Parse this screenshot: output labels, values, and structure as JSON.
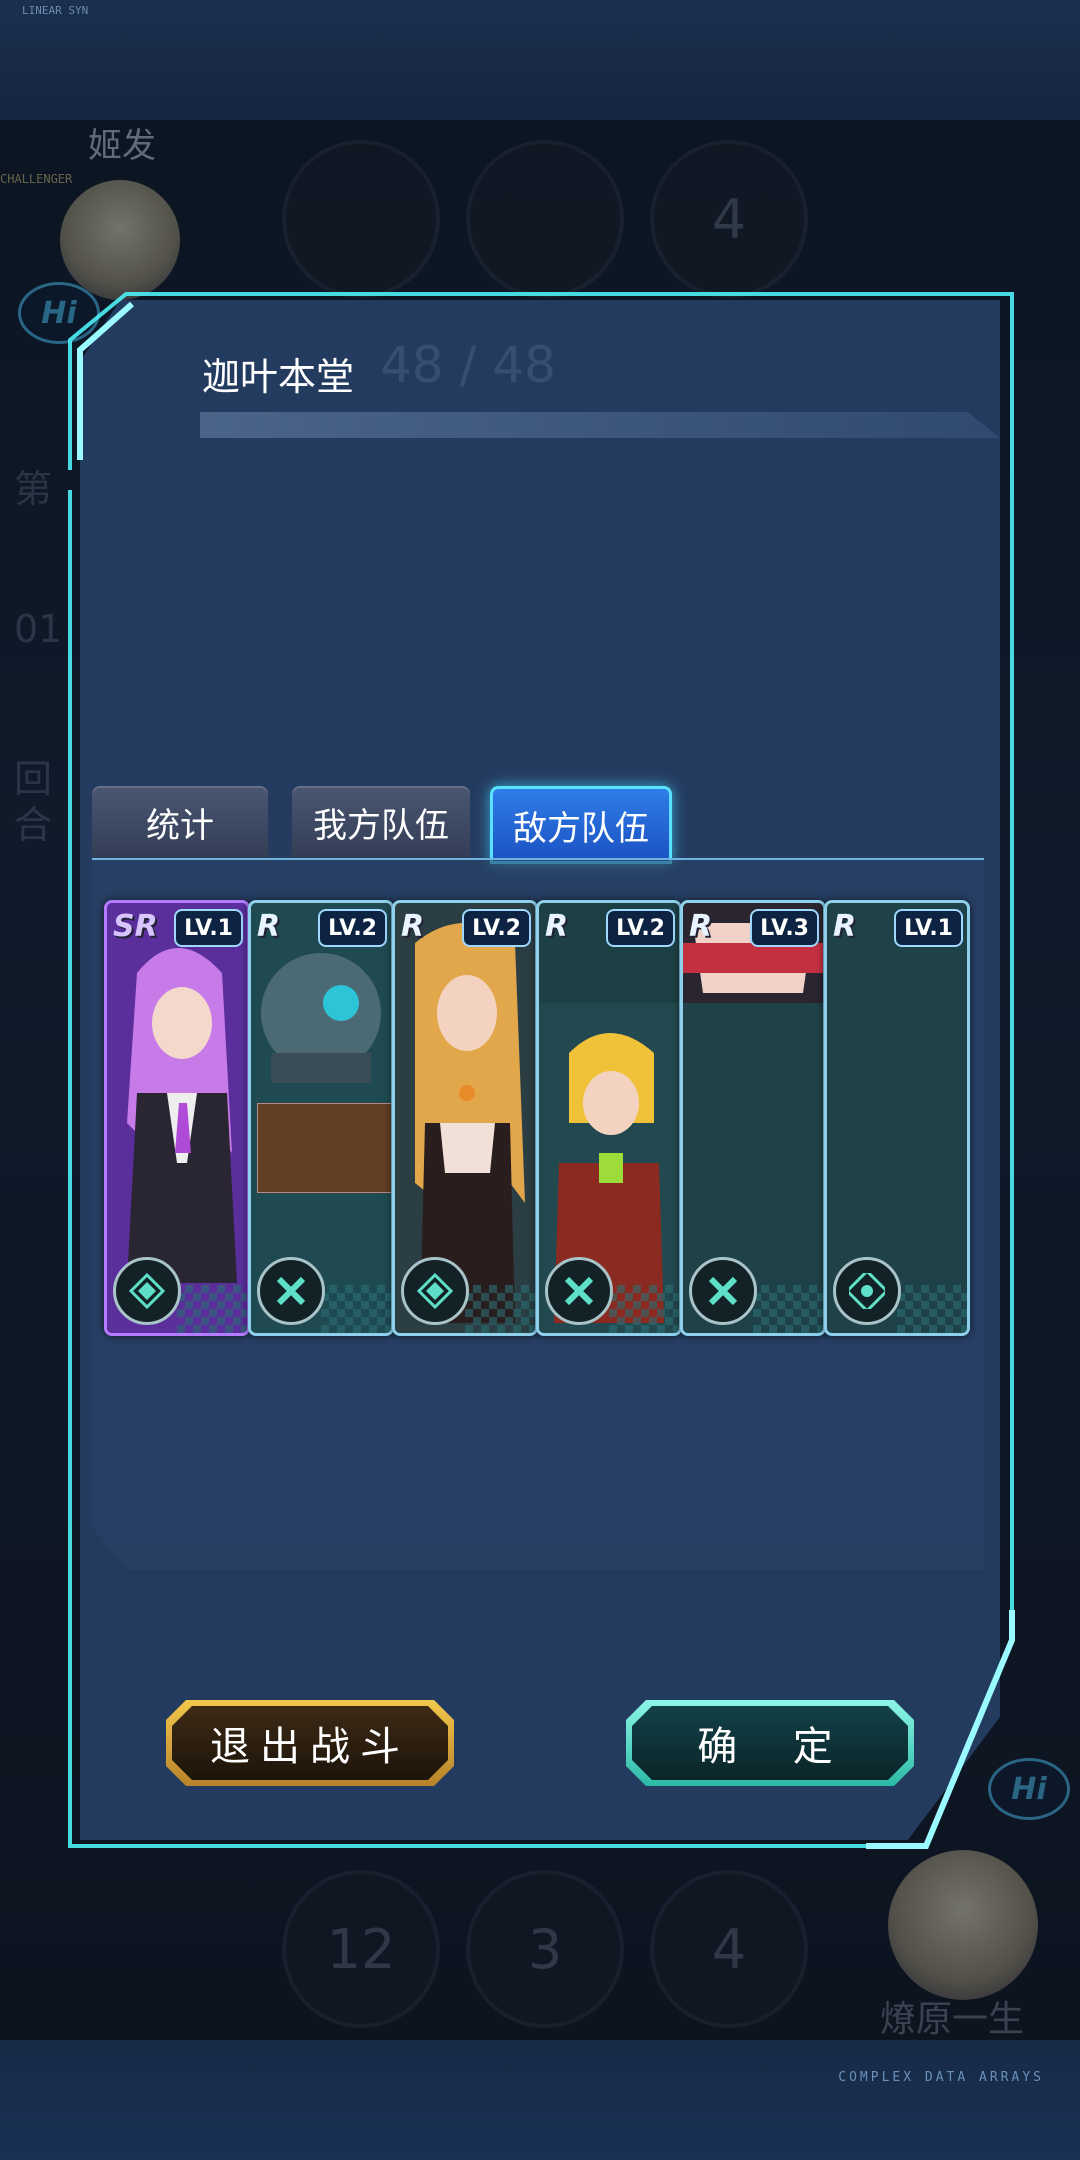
{
  "background": {
    "top_player_name": "姬发",
    "top_player_badge": "CHALLENGER",
    "hi_badge": "Hi",
    "top_slot_count": "4",
    "side_round_label": "第",
    "side_round_number": "01",
    "side_round_suffix": "回合",
    "bottom_slot_counts": [
      "12",
      "3",
      "4"
    ],
    "bottom_player_name": "燎原一生",
    "bottom_caption": "COMPLEX DATA ARRAYS",
    "ghost_deck_count": "48 / 48"
  },
  "dialog": {
    "title": "迦叶本堂",
    "tabs": [
      {
        "label": "统计",
        "active": false
      },
      {
        "label": "我方队伍",
        "active": false
      },
      {
        "label": "敌方队伍",
        "active": true
      }
    ],
    "cards": [
      {
        "rarity": "SR",
        "level": "LV.1",
        "icon": "shield-icon"
      },
      {
        "rarity": "R",
        "level": "LV.2",
        "icon": "cross-icon"
      },
      {
        "rarity": "R",
        "level": "LV.2",
        "icon": "shield-icon"
      },
      {
        "rarity": "R",
        "level": "LV.2",
        "icon": "cross-icon"
      },
      {
        "rarity": "R",
        "level": "LV.3",
        "icon": "cross-icon"
      },
      {
        "rarity": "R",
        "level": "LV.1",
        "icon": "gear-icon"
      }
    ],
    "buttons": {
      "exit": "退出战斗",
      "confirm": "确  定"
    }
  },
  "colors": {
    "accent_cyan": "#59e1ff",
    "tab_active": "#2f7de8",
    "exit_gold": "#f3c84d",
    "confirm_teal": "#2bb9a6"
  }
}
